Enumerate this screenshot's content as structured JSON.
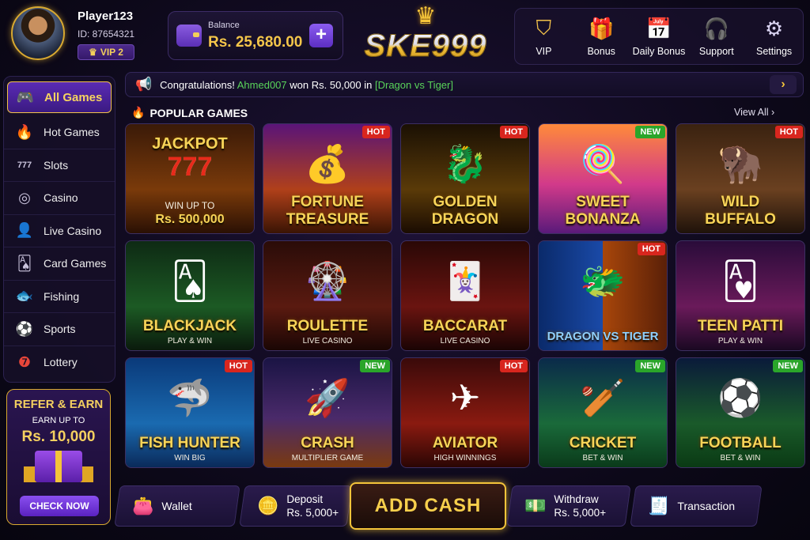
{
  "player": {
    "name": "Player123",
    "id": "ID: 87654321",
    "vip": "VIP 2"
  },
  "balance": {
    "label": "Balance",
    "value": "Rs. 25,680.00",
    "add": "+"
  },
  "brand": {
    "logo": "SKE999"
  },
  "topnav": [
    {
      "label": "VIP",
      "icon": "vip-shield-icon"
    },
    {
      "label": "Bonus",
      "icon": "gift-icon"
    },
    {
      "label": "Daily Bonus",
      "icon": "calendar-check-icon"
    },
    {
      "label": "Support",
      "icon": "headset-icon"
    },
    {
      "label": "Settings",
      "icon": "gear-icon"
    }
  ],
  "ticker": {
    "prefix": "Congratulations!",
    "user": "Ahmed007",
    "mid": "won Rs. 50,000",
    "word_in": "in",
    "game": "[Dragon vs Tiger]"
  },
  "sidebar": [
    {
      "label": "All Games",
      "icon": "gamepad-icon"
    },
    {
      "label": "Hot Games",
      "icon": "flame-icon"
    },
    {
      "label": "Slots",
      "icon": "slot-777-icon"
    },
    {
      "label": "Casino",
      "icon": "chip-icon"
    },
    {
      "label": "Live Casino",
      "icon": "dealer-icon"
    },
    {
      "label": "Card Games",
      "icon": "cards-icon"
    },
    {
      "label": "Fishing",
      "icon": "fish-icon"
    },
    {
      "label": "Sports",
      "icon": "soccer-ball-icon"
    },
    {
      "label": "Lottery",
      "icon": "lottery-ball-icon"
    }
  ],
  "refer": {
    "title": "REFER & EARN",
    "sub": "EARN UP TO",
    "amount": "Rs. 10,000",
    "button": "CHECK NOW"
  },
  "section": {
    "title": "POPULAR GAMES",
    "view_all": "View All"
  },
  "games": [
    {
      "name": "JACKPOT",
      "sub": "WIN UP TO",
      "sub2": "Rs. 500,000",
      "tag": "",
      "art": "777"
    },
    {
      "name": "FORTUNE\nTREASURE",
      "sub": "",
      "tag": "HOT",
      "art": "💰"
    },
    {
      "name": "GOLDEN\nDRAGON",
      "sub": "",
      "tag": "HOT",
      "art": "🐉"
    },
    {
      "name": "SWEET\nBONANZA",
      "sub": "",
      "tag": "NEW",
      "art": "🍭"
    },
    {
      "name": "WILD\nBUFFALO",
      "sub": "",
      "tag": "HOT",
      "art": "🦬"
    },
    {
      "name": "BLACKJACK",
      "sub": "PLAY & WIN",
      "tag": "",
      "art": "🂡"
    },
    {
      "name": "ROULETTE",
      "sub": "LIVE CASINO",
      "tag": "",
      "art": "🎡"
    },
    {
      "name": "BACCARAT",
      "sub": "LIVE CASINO",
      "tag": "",
      "art": "🃏"
    },
    {
      "name": "DRAGON VS TIGER",
      "sub": "",
      "tag": "HOT",
      "art": "🐲"
    },
    {
      "name": "TEEN PATTI",
      "sub": "PLAY & WIN",
      "tag": "",
      "art": "🂱"
    },
    {
      "name": "FISH HUNTER",
      "sub": "WIN BIG",
      "tag": "HOT",
      "art": "🦈"
    },
    {
      "name": "CRASH",
      "sub": "MULTIPLIER GAME",
      "tag": "NEW",
      "art": "🚀"
    },
    {
      "name": "AVIATOR",
      "sub": "HIGH WINNINGS",
      "tag": "HOT",
      "art": "✈"
    },
    {
      "name": "CRICKET",
      "sub": "BET & WIN",
      "tag": "NEW",
      "art": "🏏"
    },
    {
      "name": "FOOTBALL",
      "sub": "BET & WIN",
      "tag": "NEW",
      "art": "⚽"
    }
  ],
  "bottom": {
    "wallet": "Wallet",
    "deposit": "Deposit",
    "deposit_sub": "Rs. 5,000+",
    "addcash": "ADD CASH",
    "withdraw": "Withdraw",
    "withdraw_sub": "Rs. 5,000+",
    "transaction": "Transaction"
  },
  "colors": {
    "accent": "#f4c43a",
    "hot": "#d8261e",
    "new": "#2aa52a",
    "purple": "#5a2bb4"
  }
}
